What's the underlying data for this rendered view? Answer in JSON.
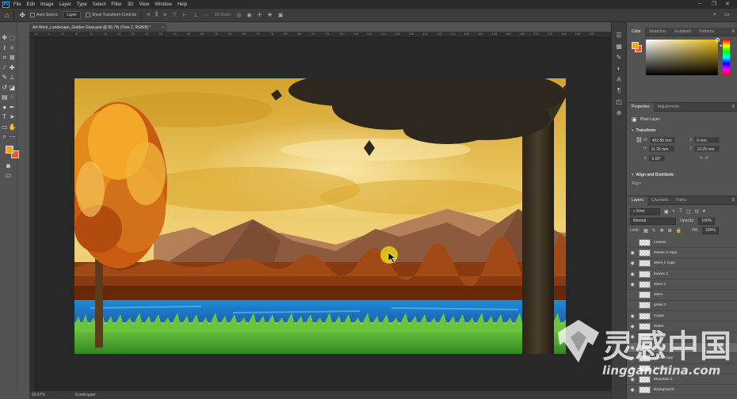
{
  "app": {
    "logo": "Ps"
  },
  "menu": [
    "File",
    "Edit",
    "Image",
    "Layer",
    "Type",
    "Select",
    "Filter",
    "3D",
    "View",
    "Window",
    "Help"
  ],
  "window_controls": [
    "–",
    "❐",
    "✕"
  ],
  "options": {
    "auto_select_label": "Auto-Select:",
    "auto_select_target": "Layer",
    "transform_controls_label": "Show Transform Controls",
    "mode_3d_label": "3D Mode:"
  },
  "document": {
    "tab_title": "Art Work_Landscape_Golden Glow.psd @ 66.7% (Tree 2, RGB/8) *",
    "close_glyph": "×"
  },
  "ruler_ticks": [
    "10",
    "5",
    "0",
    "5",
    "10",
    "15",
    "20",
    "25",
    "30",
    "35",
    "40",
    "45",
    "50",
    "55",
    "60",
    "65",
    "70",
    "75",
    "80",
    "85",
    "90",
    "95",
    "100",
    "105",
    "110",
    "115",
    "120",
    "125",
    "130",
    "135",
    "140",
    "145",
    "150",
    "155",
    "160",
    "165",
    "170",
    "175",
    "180",
    "185",
    "190"
  ],
  "status": {
    "zoom": "66.67%",
    "active_tool": "Eyedropper"
  },
  "colors": {
    "foreground": "#f0a31e",
    "background": "#f05a23",
    "accent": "#31a8ff"
  },
  "color_panel": {
    "tabs": [
      "Color",
      "Swatches",
      "Gradients",
      "Patterns"
    ]
  },
  "properties": {
    "tabs": [
      "Properties",
      "Adjustments"
    ],
    "layer_type": "Pixel Layer",
    "transform_label": "Transform",
    "fields": {
      "w": "W",
      "w_val": "402.86 mm",
      "x": "X",
      "x_val": "0 mm",
      "h": "H",
      "h_val": "11.26 mm",
      "y": "Y",
      "y_val": "10.25 mm",
      "angle": "0.00°"
    },
    "align_label": "Align and Distribute",
    "align_sub": "Align:"
  },
  "layers": {
    "tabs": [
      "Layers",
      "Channels",
      "Paths"
    ],
    "filter_kind": "Kind",
    "blend_mode": "Normal",
    "opacity_label": "Opacity:",
    "opacity_value": "100%",
    "lock_label": "Lock:",
    "fill_label": "Fill:",
    "fill_value": "100%",
    "items": [
      {
        "name": "Leaves",
        "visible": false,
        "selected": false
      },
      {
        "name": "leaves 2 copy",
        "visible": true,
        "selected": false
      },
      {
        "name": "Stem 1 copy",
        "visible": true,
        "selected": false
      },
      {
        "name": "leaves 2",
        "visible": true,
        "selected": false
      },
      {
        "name": "Stem 2",
        "visible": true,
        "selected": false
      },
      {
        "name": "Stem",
        "visible": false,
        "selected": false
      },
      {
        "name": "grass 2",
        "visible": false,
        "selected": false
      },
      {
        "name": "Grass",
        "visible": true,
        "selected": false
      },
      {
        "name": "Water",
        "visible": true,
        "selected": false
      },
      {
        "name": "Tree 1",
        "visible": true,
        "selected": false
      },
      {
        "name": "Tree 2",
        "visible": true,
        "selected": true
      },
      {
        "name": "Grass copy",
        "visible": true,
        "selected": false
      },
      {
        "name": "Mountain",
        "visible": true,
        "selected": false
      },
      {
        "name": "Mountain 1",
        "visible": true,
        "selected": false
      },
      {
        "name": "Background",
        "visible": true,
        "selected": false
      }
    ]
  },
  "watermark": {
    "cn": "灵感中国",
    "en": "lingganchina.com"
  }
}
